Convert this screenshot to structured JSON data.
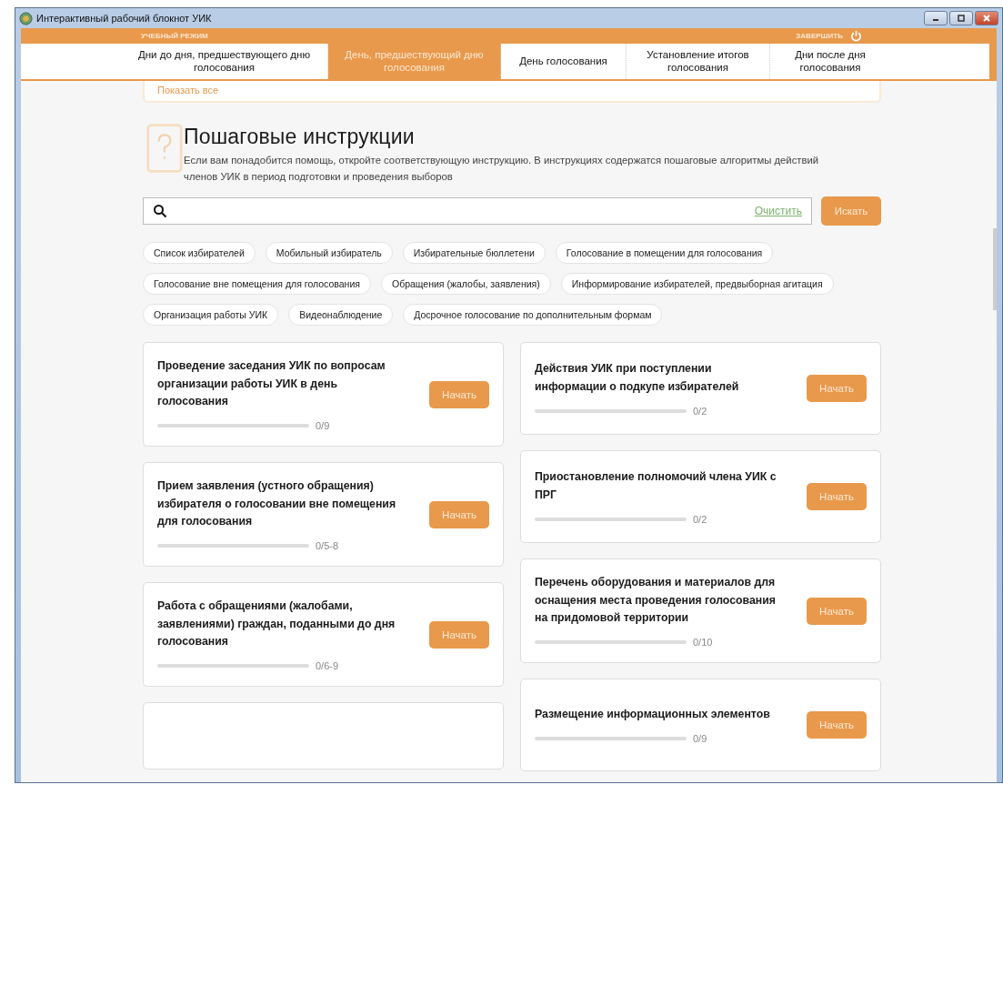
{
  "window": {
    "title": "Интерактивный рабочий блокнот УИК"
  },
  "header": {
    "mode_label": "УЧЕБНЫЙ РЕЖИМ",
    "finish_label": "ЗАВЕРШИТЬ"
  },
  "tabs": [
    {
      "label": "Дни до дня, предшествующего дню голосования",
      "selected": false
    },
    {
      "label": "День, предшествующий дню голосования",
      "selected": true
    },
    {
      "label": "День голосования",
      "selected": false
    },
    {
      "label": "Установление итогов голосования",
      "selected": false
    },
    {
      "label": "Дни после дня голосования",
      "selected": false
    }
  ],
  "top_card": {
    "link": "Показать все"
  },
  "section": {
    "title": "Пошаговые инструкции",
    "description": "Если вам понадобится помощь, откройте соответствующую инструкцию. В инструкциях содержатся пошаговые алгоритмы действий членов УИК в период подготовки и проведения выборов"
  },
  "search": {
    "clear_label": "Очистить",
    "button_label": "Искать"
  },
  "filters": [
    "Список избирателей",
    "Мобильный избиратель",
    "Избирательные бюллетени",
    "Голосование в помещении для голосования",
    "Голосование вне помещения для голосования",
    "Обращения (жалобы, заявления)",
    "Информирование избирателей, предвыборная агитация",
    "Организация работы УИК",
    "Видеонаблюдение",
    "Досрочное голосование по дополнительным формам"
  ],
  "left_cards": [
    {
      "title": "Проведение заседания УИК по вопросам организации работы УИК в день голосования",
      "level": 0,
      "progress": "0/9",
      "button": "Начать"
    },
    {
      "title": "Прием заявления (устного обращения) избирателя о голосовании вне помещения для голосования",
      "level": 0,
      "progress": "0/5-8",
      "button": "Начать"
    },
    {
      "title": "Работа с обращениями (жалобами, заявлениями) граждан, поданными до дня голосования",
      "level": 0,
      "progress": "0/6-9",
      "button": "Начать"
    }
  ],
  "right_cards": [
    {
      "title": "Действия УИК при поступлении информации о подкупе избирателей",
      "level": 0,
      "progress": "0/2",
      "button": "Начать"
    },
    {
      "title": "Приостановление полномочий члена УИК с ПРГ",
      "level": 0,
      "progress": "0/2",
      "button": "Начать"
    },
    {
      "title": "Перечень оборудования и материалов для оснащения места проведения голосования на придомовой территории",
      "level": 0,
      "progress": "0/10",
      "button": "Начать"
    },
    {
      "title": "Размещение информационных элементов",
      "level": 0,
      "progress": "0/9",
      "button": "Начать"
    }
  ]
}
